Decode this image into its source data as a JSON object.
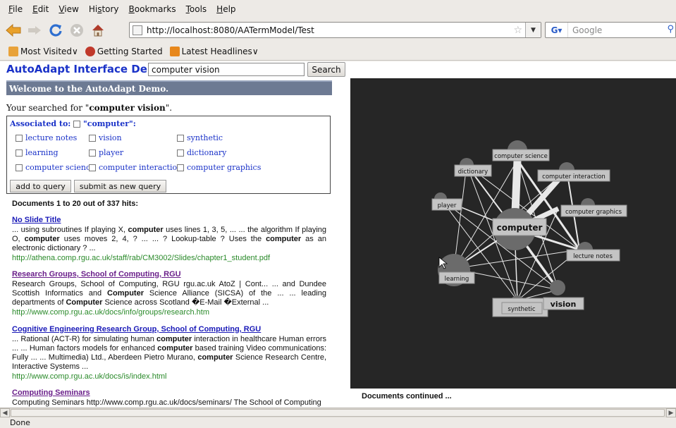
{
  "menu": [
    {
      "acc": "F",
      "rest": "ile"
    },
    {
      "acc": "E",
      "rest": "dit"
    },
    {
      "acc": "V",
      "rest": "iew"
    },
    {
      "pre": "Hi",
      "acc": "s",
      "rest": "tory"
    },
    {
      "acc": "B",
      "rest": "ookmarks"
    },
    {
      "acc": "T",
      "rest": "ools"
    },
    {
      "acc": "H",
      "rest": "elp"
    }
  ],
  "nav": {
    "url": "http://localhost:8080/AATermModel/Test",
    "search_placeholder": "Google"
  },
  "bookmarks": [
    {
      "label": "Most Visited",
      "icon": "bookmarks-folder-icon",
      "color": "#e8a23a",
      "dropdown": true
    },
    {
      "label": "Getting Started",
      "icon": "firefox-icon",
      "color": "#c0392b",
      "dropdown": false
    },
    {
      "label": "Latest Headlines",
      "icon": "rss-feed-icon",
      "color": "#e7871c",
      "dropdown": true
    }
  ],
  "page": {
    "title": "AutoAdapt Interface Demo:",
    "query": "computer vision",
    "search_button": "Search",
    "welcome": "Welcome to the AutoAdapt Demo.",
    "searched_prefix": "Your searched for \"",
    "searched_term": "computer vision",
    "searched_suffix": "\".",
    "assoc_label": "Associated to:",
    "assoc_term": "\"computer\":",
    "terms": [
      "lecture notes",
      "vision",
      "synthetic",
      "learning",
      "player",
      "dictionary",
      "computer science",
      "computer interaction",
      "computer graphics"
    ],
    "add_button": "add to query",
    "submit_button": "submit as new query",
    "docs_header": "Documents 1 to 20 out of 337 hits:",
    "docs_continued": "Documents continued ...",
    "status": "Done"
  },
  "results": [
    {
      "title": "No Slide Title",
      "visited": false,
      "snippet_parts": [
        {
          "t": "... using subroutines If playing X, ",
          "b": false
        },
        {
          "t": "computer",
          "b": true
        },
        {
          "t": " uses lines 1, 3, 5, ... ... the algorithm If playing O, ",
          "b": false
        },
        {
          "t": "computer",
          "b": true
        },
        {
          "t": " uses moves 2, 4, ? ... ... ? Lookup-table ? Uses the ",
          "b": false
        },
        {
          "t": "computer",
          "b": true
        },
        {
          "t": " as an electronic dictionary ? ...",
          "b": false
        }
      ],
      "url": "http://athena.comp.rgu.ac.uk/staff/rab/CM3002/Slides/chapter1_student.pdf"
    },
    {
      "title": "Research Groups, School of Computing, RGU",
      "visited": true,
      "snippet_parts": [
        {
          "t": "Research Groups, School of Computing, RGU rgu.ac.uk AtoZ | Cont... ... and Dundee Scottish Informatics and ",
          "b": false
        },
        {
          "t": "Computer",
          "b": true
        },
        {
          "t": " Science Alliance (SICSA) of the ... ... leading departments of ",
          "b": false
        },
        {
          "t": "Computer",
          "b": true
        },
        {
          "t": " Science across Scotland �E-Mail �External ...",
          "b": false
        }
      ],
      "url": "http://www.comp.rgu.ac.uk/docs/info/groups/research.htm"
    },
    {
      "title": "Cognitive Engineering Research Group, School of Computing, RGU",
      "visited": false,
      "snippet_parts": [
        {
          "t": "... Rational (ACT-R) for simulating human ",
          "b": false
        },
        {
          "t": "computer",
          "b": true
        },
        {
          "t": " interaction in healthcare Human errors ... ... Human factors models for enhanced ",
          "b": false
        },
        {
          "t": "computer",
          "b": true
        },
        {
          "t": " based training Video communications: Fully ... ... Multimedia) Ltd., Aberdeen Pietro Murano, ",
          "b": false
        },
        {
          "t": "computer",
          "b": true
        },
        {
          "t": " Science Research Centre, Interactive Systems ...",
          "b": false
        }
      ],
      "url": "http://www.comp.rgu.ac.uk/docs/is/index.html"
    },
    {
      "title": "Computing Seminars",
      "visited": true,
      "snippet_parts": [
        {
          "t": "Computing Seminars http://www.comp.rgu.ac.uk/docs/seminars/ The School of Computing",
          "b": false
        }
      ],
      "url": ""
    }
  ],
  "graph": {
    "center": "computer",
    "nodes": [
      "computer science",
      "computer interaction",
      "dictionary",
      "player",
      "computer graphics",
      "lecture notes",
      "learning",
      "vision",
      "synthetic"
    ],
    "colors": {
      "background": "#262626",
      "node": "#6b6b6b",
      "label_bg": "#c4c4c4",
      "edge": "#ffffff"
    }
  }
}
